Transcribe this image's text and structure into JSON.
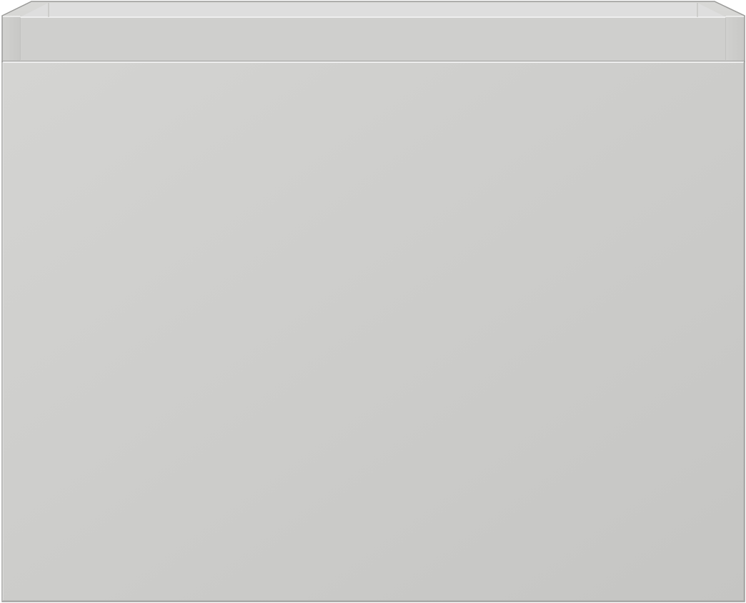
{
  "scene": {
    "subject": "cabinet-drawer-product-render",
    "colors": {
      "background": "#ffffff",
      "drawer_front_light": "#d3d3d1",
      "drawer_front_dark": "#c6c6c4",
      "top_rim": "#d6d6d4",
      "inner_back_wall": "#cfcfcd",
      "inner_floor_shadow": "#dedede",
      "side_panel": "#cccccb",
      "edge_highlight": "#f2f2f2",
      "edge_shadow": "#a9a9a7",
      "outline": "#9a9a98"
    }
  }
}
